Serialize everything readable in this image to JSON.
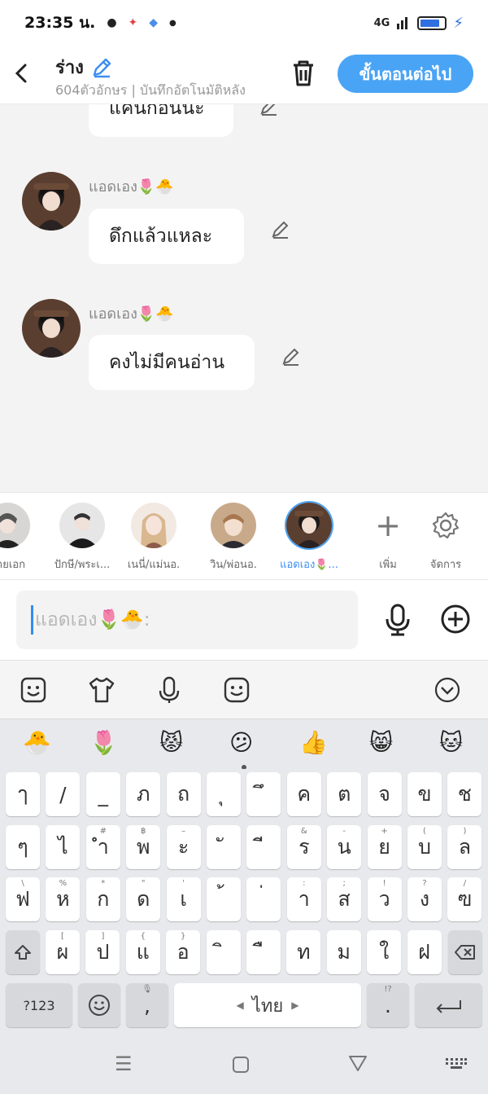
{
  "status_bar": {
    "time": "23:35 น.",
    "signal": "4G"
  },
  "header": {
    "title": "ร่าง",
    "subtitle": "604ตัวอักษร | บันทึกอัตโนมัติหลัง",
    "next_button": "ขั้นตอนต่อไป"
  },
  "messages": [
    {
      "sender": "",
      "text": "แคนกอนนะ"
    },
    {
      "sender": "แอดเอง🌷🐣",
      "text": "ดึกแล้วแหละ"
    },
    {
      "sender": "แอดเอง🌷🐣",
      "text": "คงไม่มีคนอ่าน"
    }
  ],
  "characters": [
    {
      "name": "นายเอก",
      "selected": false
    },
    {
      "name": "ปักษี/พระเ...",
      "selected": false
    },
    {
      "name": "เนนี่/แม่นอ.",
      "selected": false
    },
    {
      "name": "วิน/พ่อนอ.",
      "selected": false
    },
    {
      "name": "แอดเอง🌷...",
      "selected": true
    }
  ],
  "char_actions": {
    "add": "เพิ่ม",
    "manage": "จัดการ"
  },
  "composer": {
    "placeholder": "แอดเอง🌷🐣:"
  },
  "emoji_suggestions": [
    "🐣",
    "🌷",
    "😾",
    "😕",
    "👍",
    "😸",
    "🐱"
  ],
  "keyboard": {
    "row1": [
      {
        "k": "ๅ",
        "h": ""
      },
      {
        "k": "/",
        "h": ""
      },
      {
        "k": "_",
        "h": ""
      },
      {
        "k": "ภ",
        "h": ""
      },
      {
        "k": "ถ",
        "h": ""
      },
      {
        "k": "ุ",
        "h": ""
      },
      {
        "k": "ึ",
        "h": ""
      },
      {
        "k": "ค",
        "h": ""
      },
      {
        "k": "ต",
        "h": ""
      },
      {
        "k": "จ",
        "h": ""
      },
      {
        "k": "ข",
        "h": ""
      },
      {
        "k": "ช",
        "h": ""
      }
    ],
    "row2": [
      {
        "k": "ๆ",
        "h": ""
      },
      {
        "k": "ไ",
        "h": ""
      },
      {
        "k": "ำ",
        "h": "#"
      },
      {
        "k": "พ",
        "h": "฿"
      },
      {
        "k": "ะ",
        "h": "–"
      },
      {
        "k": "ั",
        "h": ""
      },
      {
        "k": "ี",
        "h": ""
      },
      {
        "k": "ร",
        "h": "&"
      },
      {
        "k": "น",
        "h": "-"
      },
      {
        "k": "ย",
        "h": "+"
      },
      {
        "k": "บ",
        "h": "("
      },
      {
        "k": "ล",
        "h": ")"
      }
    ],
    "row3": [
      {
        "k": "ฟ",
        "h": "\\"
      },
      {
        "k": "ห",
        "h": "%"
      },
      {
        "k": "ก",
        "h": "*"
      },
      {
        "k": "ด",
        "h": "\""
      },
      {
        "k": "เ",
        "h": "'"
      },
      {
        "k": "้",
        "h": ""
      },
      {
        "k": "่",
        "h": ""
      },
      {
        "k": "า",
        "h": ":"
      },
      {
        "k": "ส",
        "h": ";"
      },
      {
        "k": "ว",
        "h": "!"
      },
      {
        "k": "ง",
        "h": "?"
      },
      {
        "k": "ฃ",
        "h": "/"
      }
    ],
    "row4": [
      {
        "k": "ผ",
        "h": "["
      },
      {
        "k": "ป",
        "h": "]"
      },
      {
        "k": "แ",
        "h": "{"
      },
      {
        "k": "อ",
        "h": "}"
      },
      {
        "k": "ิ",
        "h": ""
      },
      {
        "k": "ื",
        "h": ""
      },
      {
        "k": "ท",
        "h": ""
      },
      {
        "k": "ม",
        "h": ""
      },
      {
        "k": "ใ",
        "h": ""
      },
      {
        "k": "ฝ",
        "h": ""
      }
    ],
    "sym_key": "?123",
    "comma": ",",
    "space_label": "ไทย",
    "period": ".",
    "period_hint": "!?"
  }
}
